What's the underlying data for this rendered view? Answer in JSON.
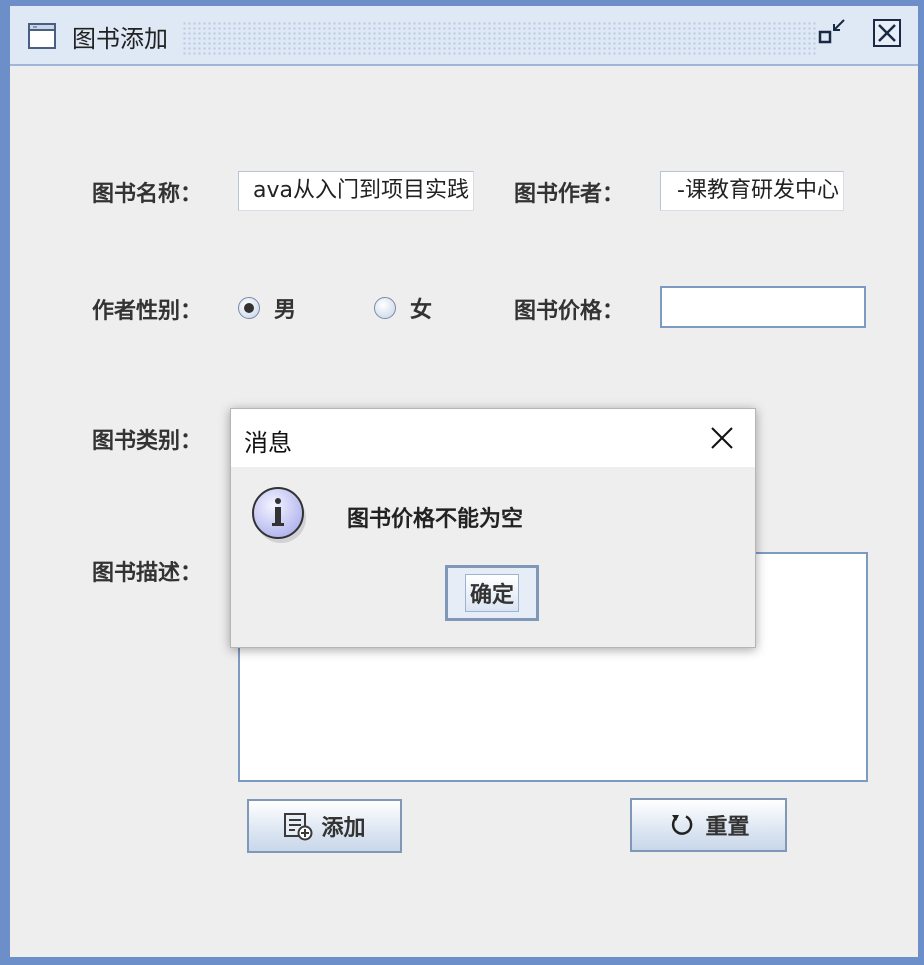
{
  "window": {
    "title": "图书添加"
  },
  "form": {
    "book_name": {
      "label": "图书名称：",
      "value": "ava从入门到项目实践"
    },
    "book_author": {
      "label": "图书作者：",
      "value": "-课教育研发中心"
    },
    "author_gender": {
      "label": "作者性别：",
      "options": [
        {
          "label": "男",
          "selected": true
        },
        {
          "label": "女",
          "selected": false
        }
      ]
    },
    "book_price": {
      "label": "图书价格：",
      "value": ""
    },
    "book_category": {
      "label": "图书类别："
    },
    "book_description": {
      "label": "图书描述：",
      "value": ""
    }
  },
  "buttons": {
    "add_label": "添加",
    "reset_label": "重置"
  },
  "dialog": {
    "title": "消息",
    "message": "图书价格不能为空",
    "ok_label": "确定",
    "icon": "info-icon"
  },
  "colors": {
    "frame_border": "#6d8fc9",
    "background": "#eeeeee"
  }
}
